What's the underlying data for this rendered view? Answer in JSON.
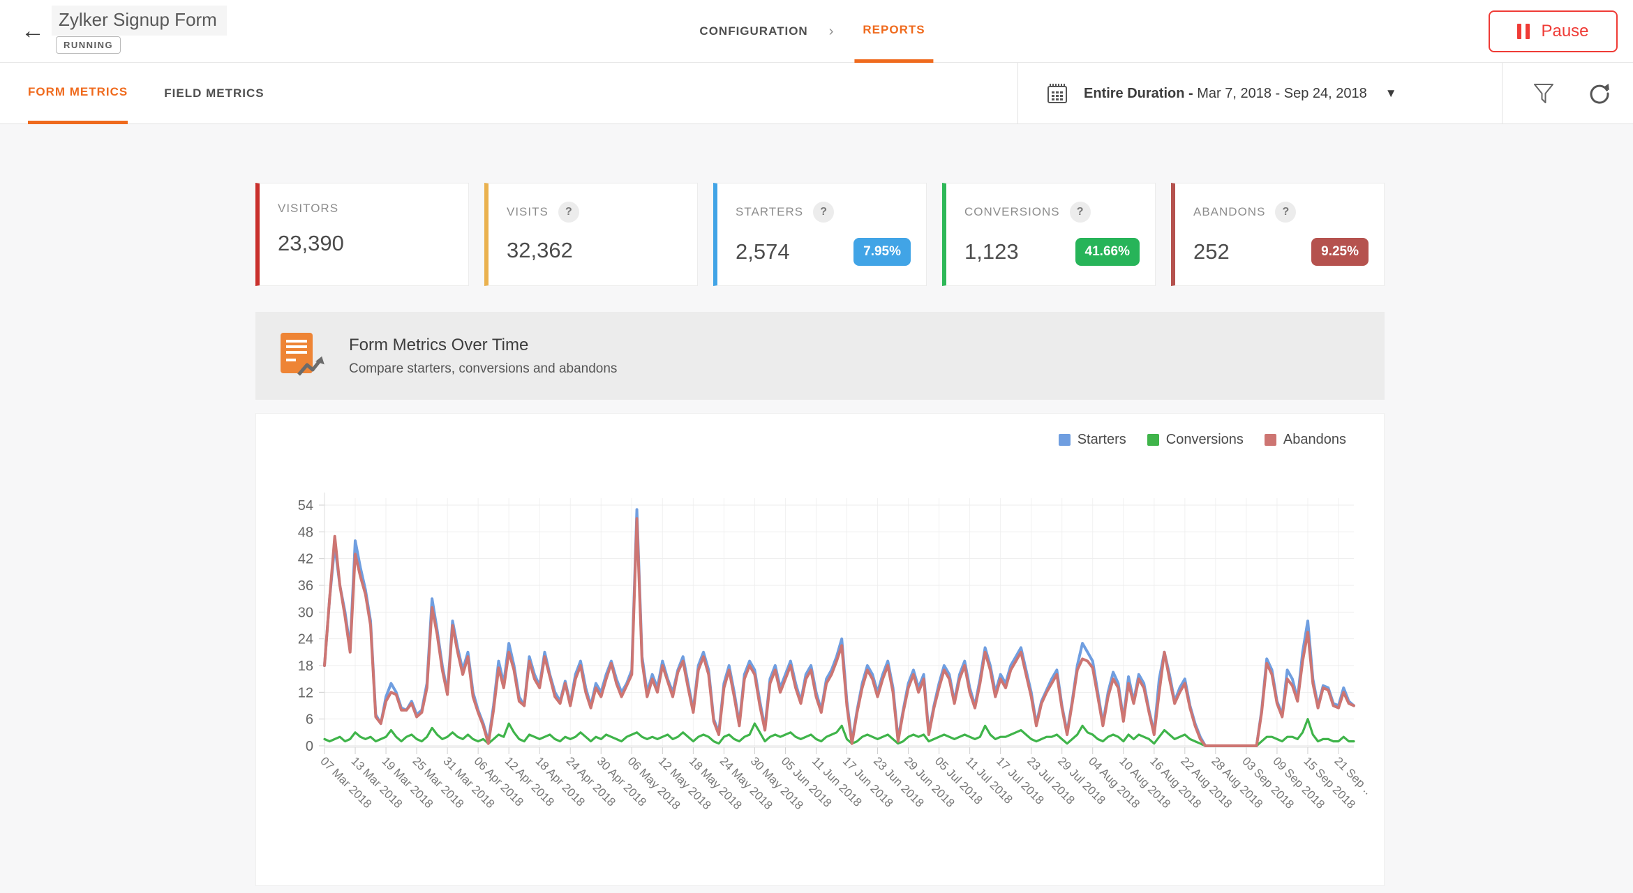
{
  "header": {
    "back_glyph": "←",
    "title": "Zylker Signup Form",
    "status_badge": "RUNNING",
    "breadcrumb": {
      "configuration": "CONFIGURATION",
      "separator": "›",
      "reports": "REPORTS"
    },
    "pause_label": "Pause"
  },
  "tabs": {
    "form_metrics": "FORM METRICS",
    "field_metrics": "FIELD METRICS"
  },
  "filter_bar": {
    "date_range_bold": "Entire Duration -",
    "date_range_rest": " Mar 7, 2018 - Sep 24, 2018",
    "caret_glyph": "▼"
  },
  "ui": {
    "help_glyph": "?"
  },
  "colors": {
    "accent_orange": "#ef6a1d",
    "pause_red": "#ef3b36",
    "banner_icon_orange": "#ee8435",
    "page_bg": "#f7f7f8"
  },
  "metrics": {
    "cards": [
      {
        "label": "VISITORS",
        "value": "23,390",
        "accent_color": "#c9302c",
        "has_help": false,
        "badge": null,
        "badge_color": null
      },
      {
        "label": "VISITS",
        "value": "32,362",
        "accent_color": "#eab14e",
        "has_help": true,
        "badge": null,
        "badge_color": null
      },
      {
        "label": "STARTERS",
        "value": "2,574",
        "accent_color": "#41a4e6",
        "has_help": true,
        "badge": "7.95%",
        "badge_color": "#41a4e6"
      },
      {
        "label": "CONVERSIONS",
        "value": "1,123",
        "accent_color": "#2eb858",
        "has_help": true,
        "badge": "41.66%",
        "badge_color": "#27b459"
      },
      {
        "label": "ABANDONS",
        "value": "252",
        "accent_color": "#b5524e",
        "has_help": true,
        "badge": "9.25%",
        "badge_color": "#b5524e"
      }
    ]
  },
  "section": {
    "title": "Form Metrics Over Time",
    "subtitle": "Compare starters, conversions and abandons"
  },
  "chart_data": {
    "type": "line",
    "title": "Form Metrics Over Time",
    "xlabel": "",
    "ylabel": "",
    "ylim": [
      0,
      54
    ],
    "y_ticks": [
      0,
      6,
      12,
      18,
      24,
      30,
      36,
      42,
      48,
      54
    ],
    "grid": true,
    "legend_position": "top-right",
    "x_start": "07 Mar 2018",
    "x_end": "24 Sep 2018",
    "n_points": 202,
    "tick_every_n_points": 6,
    "x_tick_labels": [
      "07 Mar 2018",
      "13 Mar 2018",
      "19 Mar 2018",
      "25 Mar 2018",
      "31 Mar 2018",
      "06 Apr 2018",
      "12 Apr 2018",
      "18 Apr 2018",
      "24 Apr 2018",
      "30 Apr 2018",
      "06 May 2018",
      "12 May 2018",
      "18 May 2018",
      "24 May 2018",
      "30 May 2018",
      "05 Jun 2018",
      "11 Jun 2018",
      "17 Jun 2018",
      "23 Jun 2018",
      "29 Jun 2018",
      "05 Jul 2018",
      "11 Jul 2018",
      "17 Jul 2018",
      "23 Jul 2018",
      "29 Jul 2018",
      "04 Aug 2018",
      "10 Aug 2018",
      "16 Aug 2018",
      "22 Aug 2018",
      "28 Aug 2018",
      "03 Sep 2018",
      "09 Sep 2018",
      "15 Sep 2018",
      "21 Sep .."
    ],
    "series": [
      {
        "name": "Starters",
        "color": "#6f9ee0",
        "values": [
          18,
          33,
          45,
          36,
          30,
          22,
          46,
          40,
          35,
          28,
          7,
          5,
          11,
          14,
          12,
          8.5,
          8,
          10,
          7,
          8,
          14,
          33,
          26,
          18,
          12,
          28,
          22,
          17,
          21,
          12,
          8,
          5,
          1,
          9,
          19,
          14,
          23,
          18,
          11,
          9,
          20,
          16,
          13.5,
          21,
          16,
          12,
          10,
          14.5,
          9.5,
          16,
          19,
          13,
          9,
          14,
          12,
          16,
          19,
          15,
          12,
          14,
          17,
          53,
          20,
          12,
          16,
          13,
          19,
          15,
          12,
          17,
          20,
          14,
          8,
          18,
          21,
          17,
          6,
          3,
          14,
          18,
          12,
          5,
          16,
          19,
          17,
          10,
          4,
          15,
          18,
          13,
          16,
          19,
          14,
          10,
          16,
          18,
          12,
          8,
          15,
          17,
          20,
          24,
          10,
          1,
          8,
          14,
          18,
          16,
          12,
          16,
          19,
          13,
          1.5,
          8,
          14,
          17,
          13,
          16,
          3,
          9,
          14,
          18,
          16,
          10,
          16,
          19,
          13,
          9,
          15,
          22,
          18,
          12,
          16,
          14,
          18,
          20,
          22,
          17,
          12,
          5,
          10,
          12.5,
          15,
          17,
          9,
          3,
          10,
          18,
          23,
          21,
          19,
          12,
          5,
          12,
          16.5,
          14,
          6,
          15.5,
          10,
          16,
          14,
          8,
          3,
          15,
          21,
          16,
          10,
          13,
          15,
          9,
          5,
          2,
          0,
          0,
          0,
          0,
          0,
          0,
          0,
          0,
          0,
          0,
          0,
          8,
          19.5,
          17,
          10,
          7,
          17,
          15,
          10.5,
          21,
          28,
          15,
          9,
          13.5,
          13,
          9.5,
          9,
          13,
          10,
          9
        ]
      },
      {
        "name": "Conversions",
        "color": "#3fb44a",
        "values": [
          1.5,
          1,
          1.5,
          2,
          1,
          1.5,
          3,
          2,
          1.5,
          2,
          1,
          1.5,
          2,
          3.5,
          2,
          1,
          2,
          2.5,
          1.5,
          1,
          2,
          4,
          2.5,
          1.5,
          2,
          3,
          2,
          1.5,
          2.5,
          1.5,
          1,
          1.5,
          0.5,
          1.5,
          2.5,
          2,
          5,
          3,
          1.5,
          1,
          2.5,
          2,
          1.5,
          2,
          2.5,
          1.5,
          1,
          2,
          1.5,
          2,
          3,
          2,
          1,
          2,
          1.5,
          2.5,
          2,
          1.5,
          1,
          2,
          2.5,
          3,
          2,
          1.5,
          2,
          1.5,
          2,
          2.5,
          1.5,
          2,
          3,
          2,
          1,
          2,
          2.5,
          2,
          1,
          0.5,
          2,
          2.5,
          1.5,
          1,
          2,
          2.5,
          5,
          3,
          1,
          2,
          2.5,
          2,
          2.5,
          3,
          2,
          1.5,
          2,
          2.5,
          1.5,
          1,
          2,
          2.5,
          3,
          4.5,
          1.5,
          0.5,
          1,
          2,
          2.5,
          2,
          1.5,
          2,
          2.5,
          1.5,
          0.5,
          1,
          2,
          2.5,
          2,
          2.5,
          1,
          1.5,
          2,
          2.5,
          2,
          1.5,
          2,
          2.5,
          2,
          1.5,
          2,
          4.5,
          2.5,
          1.5,
          2,
          2,
          2.5,
          3,
          3.5,
          2.5,
          1.5,
          1,
          1.5,
          2,
          2,
          2.5,
          1.5,
          0.5,
          1.5,
          2.5,
          4.5,
          3,
          2.5,
          1.5,
          1,
          2,
          2.5,
          2,
          1,
          2.5,
          1.5,
          2.5,
          2,
          1.5,
          0.5,
          2,
          3.5,
          2.5,
          1.5,
          2,
          2.5,
          1.5,
          1,
          0.5,
          0,
          0,
          0,
          0,
          0,
          0,
          0,
          0,
          0,
          0,
          0,
          1,
          2,
          2,
          1.5,
          1,
          2,
          2,
          1.5,
          3,
          6,
          2.5,
          1,
          1.5,
          1.5,
          1,
          1,
          2,
          1,
          1
        ]
      },
      {
        "name": "Abandons",
        "color": "#cd7572",
        "values": [
          18,
          33,
          47,
          36,
          29,
          21,
          43,
          38,
          34,
          27,
          6.5,
          5,
          10,
          12,
          11.5,
          8,
          8,
          9.5,
          6.5,
          7.5,
          13,
          31,
          25,
          17,
          11.5,
          27,
          21,
          16,
          20,
          11,
          7.5,
          4.5,
          0.5,
          8,
          17.5,
          13,
          21,
          17,
          10,
          9,
          19,
          15,
          13,
          20,
          15.5,
          11,
          9.5,
          14,
          9,
          15,
          18,
          12,
          8.5,
          13,
          11,
          15,
          18.5,
          14,
          11,
          13.5,
          16,
          51,
          19,
          11,
          15,
          12,
          18,
          14.5,
          11,
          16.5,
          19,
          13,
          7.5,
          17,
          20,
          16,
          5.5,
          2.5,
          13,
          17,
          11,
          4.5,
          15,
          18,
          16,
          9,
          3.5,
          14,
          17,
          12,
          15,
          18,
          13,
          9.5,
          15,
          17,
          11,
          7.5,
          14,
          16,
          19,
          22.5,
          9,
          0.5,
          7.5,
          13,
          17,
          15,
          11,
          15,
          18,
          12,
          1,
          7.5,
          13,
          16,
          12,
          15,
          2.5,
          8.5,
          13,
          17,
          15,
          9.5,
          15,
          18,
          12,
          8.5,
          14,
          21,
          17,
          11,
          15,
          13,
          17,
          19,
          21,
          16,
          11,
          4.5,
          9.5,
          12,
          14,
          16,
          8.5,
          2.5,
          9.5,
          17,
          19.5,
          19,
          17.5,
          11,
          4.5,
          11,
          15,
          13,
          5.5,
          14,
          9.5,
          15,
          13,
          7.5,
          2.5,
          12,
          21,
          15,
          9.5,
          12,
          14,
          8.5,
          4.5,
          1.5,
          0,
          0,
          0,
          0,
          0,
          0,
          0,
          0,
          0,
          0,
          0,
          7.5,
          18.5,
          16,
          9.5,
          6.5,
          15,
          13.5,
          10,
          19,
          25.5,
          14,
          8.5,
          13,
          12.5,
          9,
          8.5,
          12,
          9.5,
          9
        ]
      }
    ]
  }
}
